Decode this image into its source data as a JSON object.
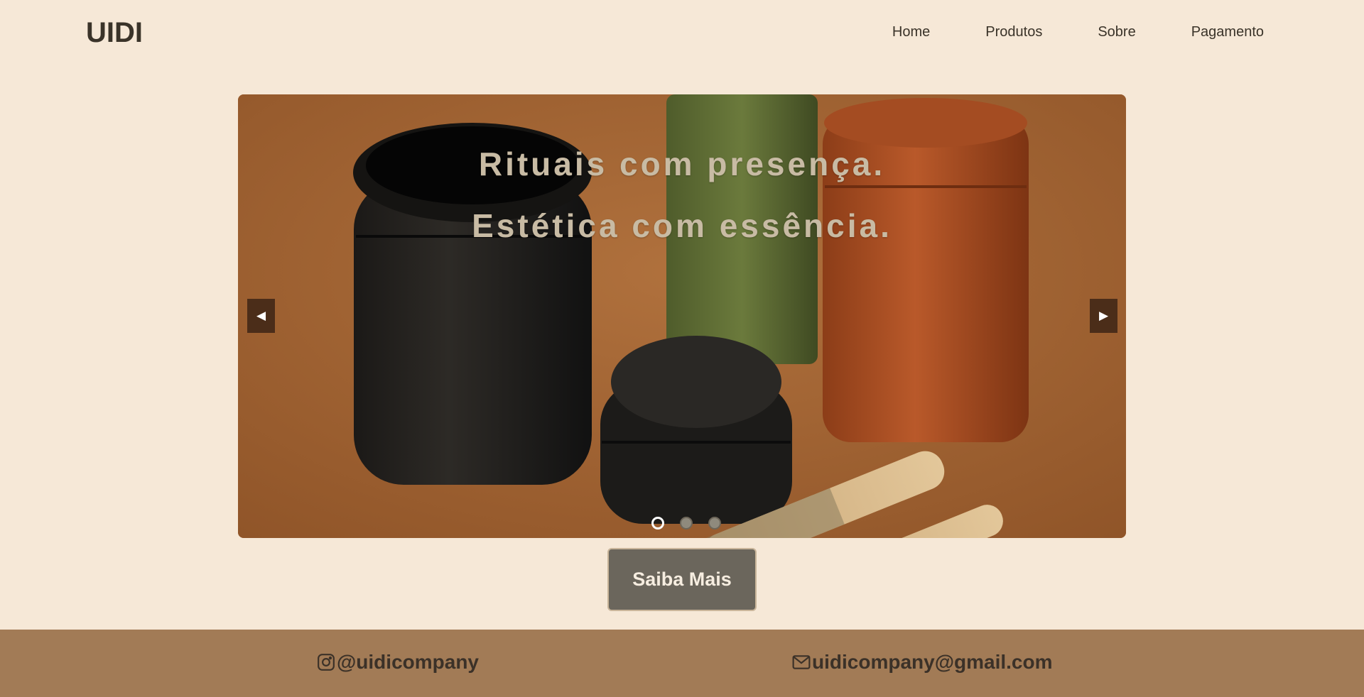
{
  "header": {
    "logo": "UIDI",
    "nav": [
      {
        "label": "Home"
      },
      {
        "label": "Produtos"
      },
      {
        "label": "Sobre"
      },
      {
        "label": "Pagamento"
      }
    ]
  },
  "hero": {
    "line1": "Rituais com presença.",
    "line2": "Estética com essência.",
    "prev_icon": "◀",
    "next_icon": "▶",
    "slides_count": 3,
    "active_slide": 1,
    "image_description_icon": "product-photo"
  },
  "cta": {
    "label": "Saiba Mais"
  },
  "footer": {
    "instagram": "@uidicompany",
    "instagram_icon": "instagram-icon",
    "email": "uidicompany@gmail.com",
    "email_icon": "mail-icon"
  },
  "colors": {
    "background": "#f6e8d7",
    "footer": "#a27b56",
    "arrow": "#4b2d19",
    "button": "#6b665c"
  }
}
